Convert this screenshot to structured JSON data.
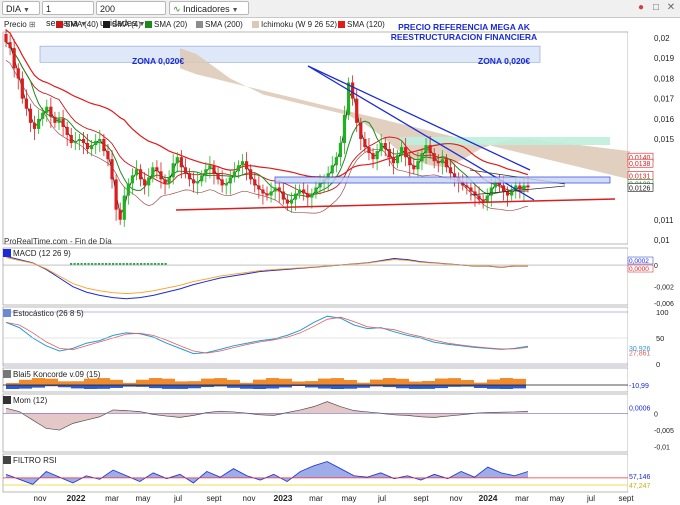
{
  "toolbar": {
    "ticker": "DIA",
    "period": "1 semana",
    "units": "200 unidades",
    "indicators_label": "Indicadores",
    "price_style": "Precio"
  },
  "legend": {
    "sma40": "SMA (40)",
    "sma4": "SMA (4)",
    "sma20": "SMA (20)",
    "sma200": "SMA (200)",
    "ichimoku": "Ichimoku (W 9 26 52)",
    "sma120": "SMA (120)"
  },
  "colors": {
    "up": "#1fb21f",
    "down": "#d81e1e",
    "sma40": "#c81818",
    "sma4": "#1a1a1a",
    "sma20": "#1e8a1e",
    "sma200": "#8c8c8c",
    "sma120": "#e21a1a",
    "kumo": "#dcc8b4",
    "accent": "#1a2bd6"
  },
  "annotations": {
    "title_line1": "PRECIO REFERENCIA MEGA AK",
    "title_line2": "REESTRUCTURACION FINANCIERA",
    "zone_left": "ZONA 0,020€",
    "zone_right": "ZONA 0,020€",
    "source": "ProRealTime.com - Fin de Día"
  },
  "panels": {
    "macd": "MACD (12 26 9)",
    "stoch": "Estocástico (26 8 5)",
    "koncorde": "Blai5 Koncorde v.09 (15)",
    "mom": "Mom (12)",
    "rsi": "FILTRO RSI"
  },
  "chart_data": {
    "type": "candlestick",
    "x_labels": [
      "nov",
      "2022",
      "mar",
      "may",
      "jul",
      "sept",
      "nov",
      "2023",
      "mar",
      "may",
      "jul",
      "sept",
      "nov",
      "2024",
      "mar",
      "may",
      "jul",
      "sept"
    ],
    "y_ticks": [
      "0,02",
      "0,019",
      "0,018",
      "0,017",
      "0,016",
      "0,015",
      "0,011",
      "0,01"
    ],
    "price_labels": [
      "0,0140",
      "0,0138",
      "0,0131",
      "0,0128",
      "0,0126"
    ],
    "price_close": [
      0.0198,
      0.0195,
      0.0185,
      0.018,
      0.017,
      0.0165,
      0.0158,
      0.0155,
      0.016,
      0.0163,
      0.0166,
      0.0161,
      0.0158,
      0.016,
      0.0156,
      0.0152,
      0.0148,
      0.0149,
      0.015,
      0.0148,
      0.0145,
      0.0147,
      0.0149,
      0.015,
      0.0144,
      0.014,
      0.013,
      0.0115,
      0.011,
      0.0122,
      0.0128,
      0.0132,
      0.0135,
      0.013,
      0.0127,
      0.0131,
      0.0136,
      0.0134,
      0.013,
      0.0128,
      0.0131,
      0.0138,
      0.0141,
      0.0136,
      0.0133,
      0.013,
      0.0128,
      0.0129,
      0.0132,
      0.0135,
      0.0137,
      0.0133,
      0.013,
      0.0127,
      0.0128,
      0.0131,
      0.0134,
      0.0137,
      0.0139,
      0.0135,
      0.013,
      0.0127,
      0.0125,
      0.0123,
      0.0122,
      0.0124,
      0.0126,
      0.0124,
      0.012,
      0.0118,
      0.012,
      0.0123,
      0.0125,
      0.0123,
      0.0121,
      0.0123,
      0.0126,
      0.0128,
      0.013,
      0.0133,
      0.0137,
      0.0141,
      0.0148,
      0.0162,
      0.0178,
      0.017,
      0.0158,
      0.015,
      0.0146,
      0.0143,
      0.014,
      0.0144,
      0.0148,
      0.0145,
      0.0141,
      0.0138,
      0.0142,
      0.0146,
      0.0141,
      0.0137,
      0.0135,
      0.0139,
      0.0143,
      0.0147,
      0.0143,
      0.0139,
      0.0138,
      0.014,
      0.0136,
      0.0133,
      0.0131,
      0.0129,
      0.0127,
      0.0126,
      0.0124,
      0.0122,
      0.012,
      0.0119,
      0.0122,
      0.0126,
      0.0129,
      0.0127,
      0.0124,
      0.0122,
      0.0124,
      0.0127,
      0.0125,
      0.0127,
      0.0126
    ],
    "ichimoku_span_a": [
      0.0185,
      0.0182,
      0.018,
      0.0178,
      0.0176,
      0.0174,
      0.0172,
      0.017,
      0.0168,
      0.0166,
      0.0164,
      0.0162,
      0.016,
      0.0158,
      0.0156,
      0.0154,
      0.0152,
      0.015,
      0.0148,
      0.0146,
      0.0144,
      0.0142,
      0.014,
      0.0138,
      0.0136,
      0.0134,
      0.0132,
      0.013
    ],
    "ichimoku_span_b": [
      0.0195,
      0.0192,
      0.0186,
      0.018,
      0.0176,
      0.0172,
      0.017,
      0.0168,
      0.0166,
      0.0164,
      0.0162,
      0.0158,
      0.0152,
      0.0145,
      0.014,
      0.0137,
      0.0136,
      0.014,
      0.0145,
      0.0148,
      0.015,
      0.015,
      0.0149,
      0.0148,
      0.0147,
      0.0146,
      0.0145,
      0.0144
    ],
    "macd": [
      0.0008,
      0.0005,
      0.0002,
      -0.0004,
      -0.0012,
      -0.002,
      -0.0025,
      -0.0028,
      -0.003,
      -0.0031,
      -0.003,
      -0.0028,
      -0.0025,
      -0.0022,
      -0.0018,
      -0.0015,
      -0.0012,
      -0.001,
      -0.0008,
      -0.0006,
      -0.0005,
      -0.0004,
      -0.0003,
      -0.0002,
      -0.0001,
      0.0,
      0.0001,
      0.0002,
      0.0004,
      0.0006,
      0.0005,
      0.0003,
      0.0002,
      0.0001,
      0.0,
      -0.0001,
      -0.0001,
      -0.0002,
      -0.0001,
      -0.0001
    ],
    "macd_labels": [
      "0",
      "-0,002",
      "-0,004",
      "-0,006"
    ],
    "stoch": [
      80,
      70,
      50,
      35,
      25,
      30,
      40,
      45,
      55,
      60,
      58,
      52,
      40,
      30,
      20,
      22,
      28,
      35,
      40,
      45,
      48,
      55,
      65,
      80,
      92,
      88,
      75,
      68,
      70,
      62,
      55,
      50,
      42,
      38,
      35,
      32,
      30,
      28,
      30,
      34
    ],
    "stoch_labels": [
      "100",
      "50",
      "0"
    ],
    "stoch_value": "30,926",
    "stoch_value2": "27,861",
    "mom": [
      0.0015,
      0.0005,
      -0.002,
      -0.0045,
      -0.005,
      -0.003,
      -0.002,
      -0.001,
      0.001,
      0.0008,
      0.0005,
      -0.0003,
      -0.0008,
      -0.0012,
      -0.0006,
      0.0002,
      0.0006,
      0.0004,
      0.0,
      -0.0004,
      -0.0006,
      0.0002,
      0.001,
      0.002,
      0.0035,
      0.002,
      0.0008,
      0.0004,
      0.0,
      -0.0004,
      -0.0006,
      -0.001,
      -0.0012,
      -0.0008,
      -0.0004,
      0.0,
      0.0002,
      0.0003,
      0.0004,
      0.0006
    ],
    "mom_labels": [
      "0",
      "-0,005",
      "-0,01"
    ],
    "mom_value": "0,0006",
    "koncorde_value": "-10,99",
    "rsi": [
      62,
      55,
      48,
      66,
      58,
      50,
      60,
      55,
      68,
      60,
      52,
      64,
      56,
      62,
      50,
      66,
      58,
      70,
      60,
      54,
      62,
      52,
      66,
      74,
      80,
      70,
      60,
      58,
      64,
      56,
      60,
      54,
      62,
      56,
      66,
      58,
      72,
      64,
      60,
      66
    ],
    "rsi_value": "57,146",
    "rsi_value2": "47,247",
    "macd_values": [
      "0,0000",
      "0,0002"
    ]
  }
}
